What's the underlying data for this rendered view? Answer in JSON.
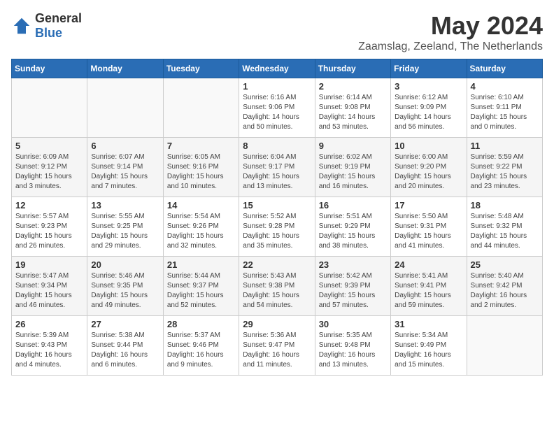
{
  "header": {
    "logo_general": "General",
    "logo_blue": "Blue",
    "month_year": "May 2024",
    "location": "Zaamslag, Zeeland, The Netherlands"
  },
  "weekdays": [
    "Sunday",
    "Monday",
    "Tuesday",
    "Wednesday",
    "Thursday",
    "Friday",
    "Saturday"
  ],
  "weeks": [
    [
      {
        "day": "",
        "info": ""
      },
      {
        "day": "",
        "info": ""
      },
      {
        "day": "",
        "info": ""
      },
      {
        "day": "1",
        "info": "Sunrise: 6:16 AM\nSunset: 9:06 PM\nDaylight: 14 hours\nand 50 minutes."
      },
      {
        "day": "2",
        "info": "Sunrise: 6:14 AM\nSunset: 9:08 PM\nDaylight: 14 hours\nand 53 minutes."
      },
      {
        "day": "3",
        "info": "Sunrise: 6:12 AM\nSunset: 9:09 PM\nDaylight: 14 hours\nand 56 minutes."
      },
      {
        "day": "4",
        "info": "Sunrise: 6:10 AM\nSunset: 9:11 PM\nDaylight: 15 hours\nand 0 minutes."
      }
    ],
    [
      {
        "day": "5",
        "info": "Sunrise: 6:09 AM\nSunset: 9:12 PM\nDaylight: 15 hours\nand 3 minutes."
      },
      {
        "day": "6",
        "info": "Sunrise: 6:07 AM\nSunset: 9:14 PM\nDaylight: 15 hours\nand 7 minutes."
      },
      {
        "day": "7",
        "info": "Sunrise: 6:05 AM\nSunset: 9:16 PM\nDaylight: 15 hours\nand 10 minutes."
      },
      {
        "day": "8",
        "info": "Sunrise: 6:04 AM\nSunset: 9:17 PM\nDaylight: 15 hours\nand 13 minutes."
      },
      {
        "day": "9",
        "info": "Sunrise: 6:02 AM\nSunset: 9:19 PM\nDaylight: 15 hours\nand 16 minutes."
      },
      {
        "day": "10",
        "info": "Sunrise: 6:00 AM\nSunset: 9:20 PM\nDaylight: 15 hours\nand 20 minutes."
      },
      {
        "day": "11",
        "info": "Sunrise: 5:59 AM\nSunset: 9:22 PM\nDaylight: 15 hours\nand 23 minutes."
      }
    ],
    [
      {
        "day": "12",
        "info": "Sunrise: 5:57 AM\nSunset: 9:23 PM\nDaylight: 15 hours\nand 26 minutes."
      },
      {
        "day": "13",
        "info": "Sunrise: 5:55 AM\nSunset: 9:25 PM\nDaylight: 15 hours\nand 29 minutes."
      },
      {
        "day": "14",
        "info": "Sunrise: 5:54 AM\nSunset: 9:26 PM\nDaylight: 15 hours\nand 32 minutes."
      },
      {
        "day": "15",
        "info": "Sunrise: 5:52 AM\nSunset: 9:28 PM\nDaylight: 15 hours\nand 35 minutes."
      },
      {
        "day": "16",
        "info": "Sunrise: 5:51 AM\nSunset: 9:29 PM\nDaylight: 15 hours\nand 38 minutes."
      },
      {
        "day": "17",
        "info": "Sunrise: 5:50 AM\nSunset: 9:31 PM\nDaylight: 15 hours\nand 41 minutes."
      },
      {
        "day": "18",
        "info": "Sunrise: 5:48 AM\nSunset: 9:32 PM\nDaylight: 15 hours\nand 44 minutes."
      }
    ],
    [
      {
        "day": "19",
        "info": "Sunrise: 5:47 AM\nSunset: 9:34 PM\nDaylight: 15 hours\nand 46 minutes."
      },
      {
        "day": "20",
        "info": "Sunrise: 5:46 AM\nSunset: 9:35 PM\nDaylight: 15 hours\nand 49 minutes."
      },
      {
        "day": "21",
        "info": "Sunrise: 5:44 AM\nSunset: 9:37 PM\nDaylight: 15 hours\nand 52 minutes."
      },
      {
        "day": "22",
        "info": "Sunrise: 5:43 AM\nSunset: 9:38 PM\nDaylight: 15 hours\nand 54 minutes."
      },
      {
        "day": "23",
        "info": "Sunrise: 5:42 AM\nSunset: 9:39 PM\nDaylight: 15 hours\nand 57 minutes."
      },
      {
        "day": "24",
        "info": "Sunrise: 5:41 AM\nSunset: 9:41 PM\nDaylight: 15 hours\nand 59 minutes."
      },
      {
        "day": "25",
        "info": "Sunrise: 5:40 AM\nSunset: 9:42 PM\nDaylight: 16 hours\nand 2 minutes."
      }
    ],
    [
      {
        "day": "26",
        "info": "Sunrise: 5:39 AM\nSunset: 9:43 PM\nDaylight: 16 hours\nand 4 minutes."
      },
      {
        "day": "27",
        "info": "Sunrise: 5:38 AM\nSunset: 9:44 PM\nDaylight: 16 hours\nand 6 minutes."
      },
      {
        "day": "28",
        "info": "Sunrise: 5:37 AM\nSunset: 9:46 PM\nDaylight: 16 hours\nand 9 minutes."
      },
      {
        "day": "29",
        "info": "Sunrise: 5:36 AM\nSunset: 9:47 PM\nDaylight: 16 hours\nand 11 minutes."
      },
      {
        "day": "30",
        "info": "Sunrise: 5:35 AM\nSunset: 9:48 PM\nDaylight: 16 hours\nand 13 minutes."
      },
      {
        "day": "31",
        "info": "Sunrise: 5:34 AM\nSunset: 9:49 PM\nDaylight: 16 hours\nand 15 minutes."
      },
      {
        "day": "",
        "info": ""
      }
    ]
  ]
}
